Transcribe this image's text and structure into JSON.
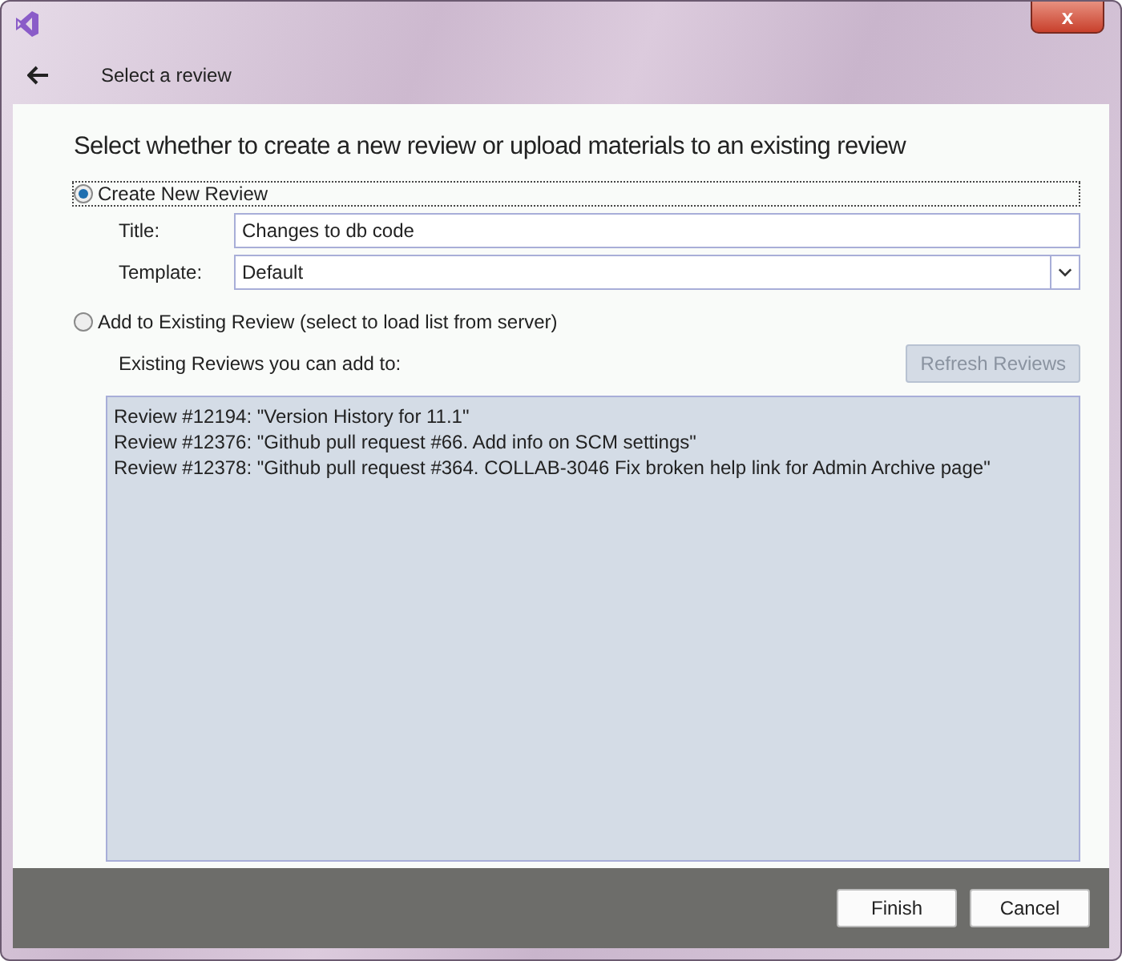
{
  "window": {
    "page_title": "Select a review",
    "close_label": "x"
  },
  "heading": "Select whether to create a new review or upload materials to an existing review",
  "options": [
    {
      "label": "Create New Review",
      "selected": true
    },
    {
      "label": "Add to Existing Review (select to load list from server)",
      "selected": false
    }
  ],
  "new_review": {
    "title_label": "Title:",
    "title_value": "Changes to db code",
    "template_label": "Template:",
    "template_value": "Default"
  },
  "existing": {
    "label": "Existing Reviews you can add to:",
    "refresh_button": {
      "label": "Refresh Reviews",
      "disabled": true
    },
    "reviews": [
      "Review #12194: \"Version History for 11.1\"",
      "Review #12376: \"Github pull request #66. Add info on SCM settings\"",
      "Review #12378: \"Github pull request #364. COLLAB-3046 Fix broken help link for Admin Archive page\""
    ]
  },
  "buttons": [
    "Finish",
    "Cancel"
  ]
}
